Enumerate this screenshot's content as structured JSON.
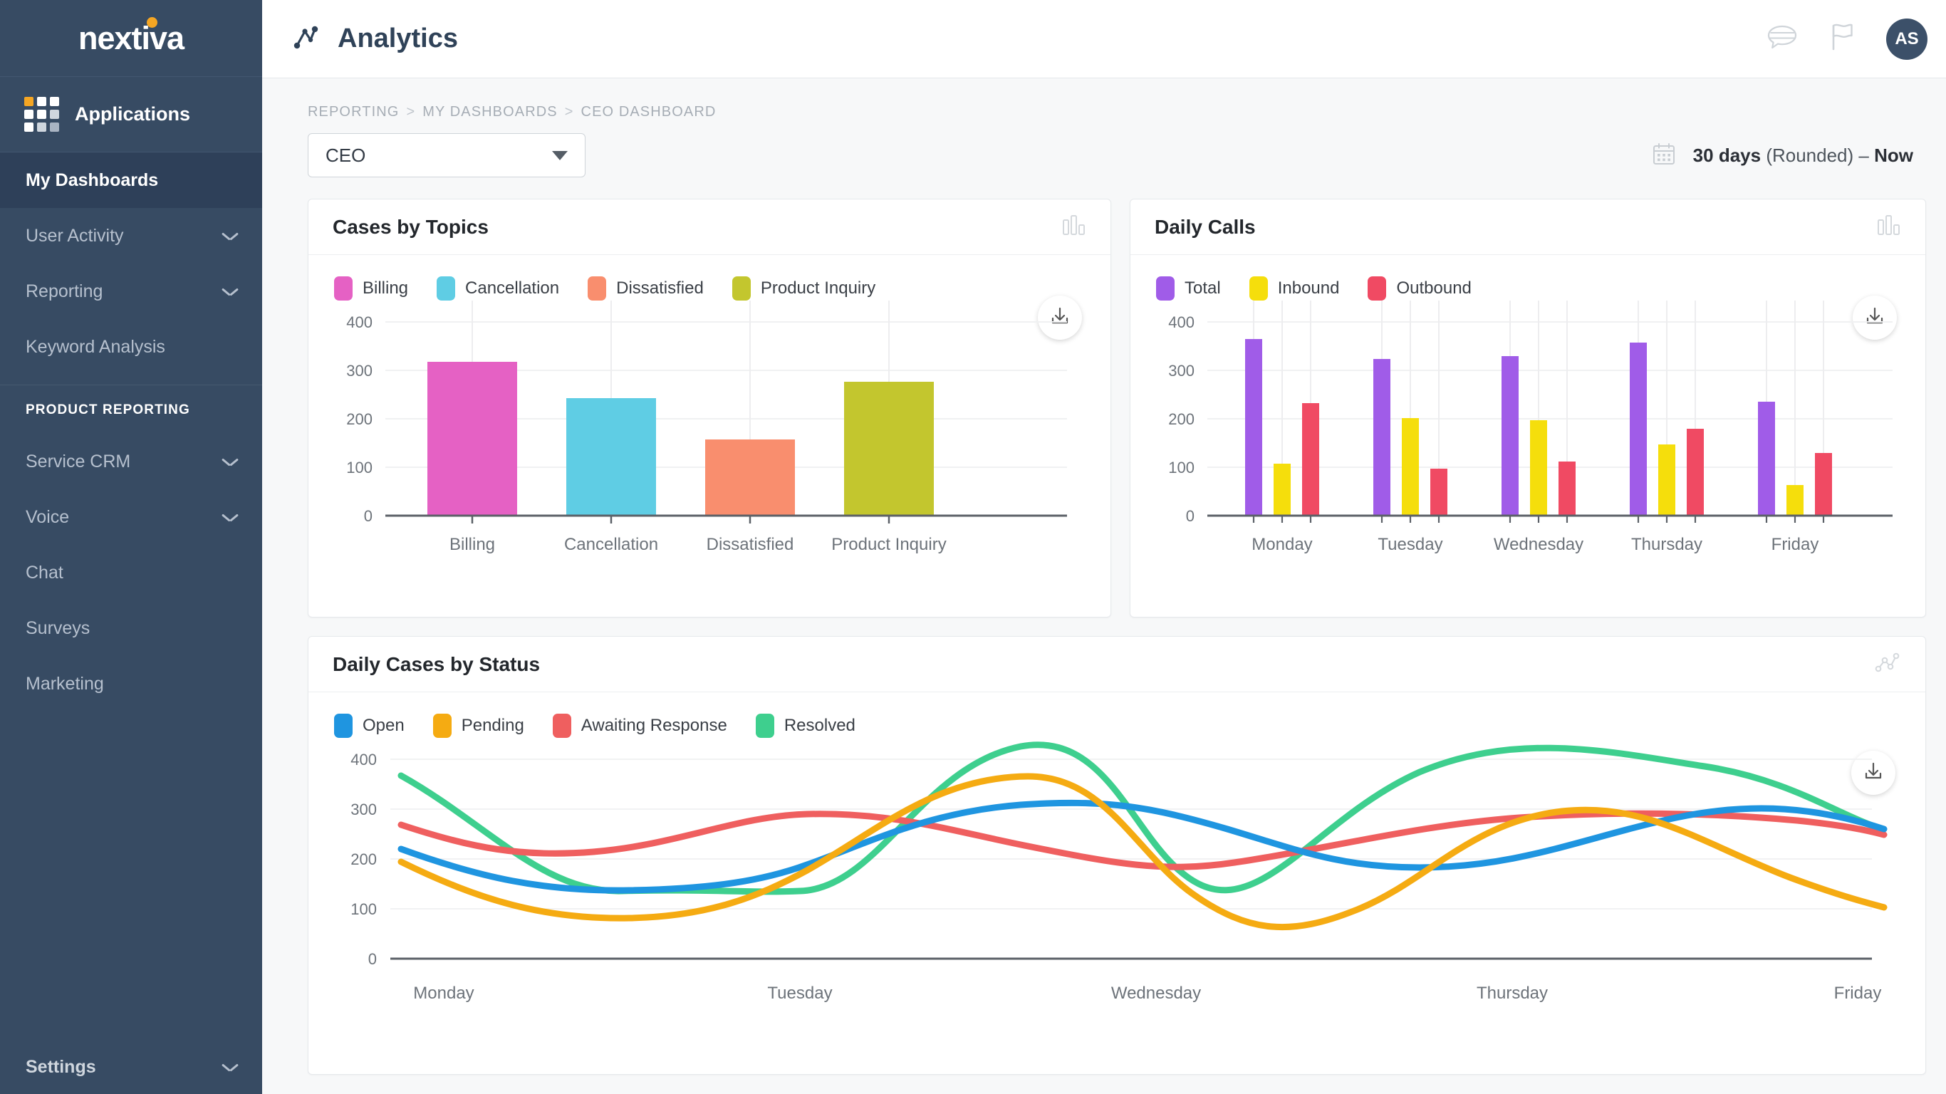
{
  "sidebar": {
    "logo": "nextiva",
    "applications_label": "Applications",
    "items": [
      {
        "label": "My Dashboards",
        "active": true,
        "chevron": false
      },
      {
        "label": "User Activity",
        "active": false,
        "chevron": true
      },
      {
        "label": "Reporting",
        "active": false,
        "chevron": true
      },
      {
        "label": "Keyword Analysis",
        "active": false,
        "chevron": false
      }
    ],
    "section_title": "PRODUCT REPORTING",
    "product_items": [
      {
        "label": "Service CRM",
        "chevron": true
      },
      {
        "label": "Voice",
        "chevron": true
      },
      {
        "label": "Chat",
        "chevron": false
      },
      {
        "label": "Surveys",
        "chevron": false
      },
      {
        "label": "Marketing",
        "chevron": false
      }
    ],
    "settings_label": "Settings"
  },
  "topbar": {
    "title": "Analytics",
    "avatar_initials": "AS"
  },
  "breadcrumb": {
    "items": [
      "REPORTING",
      "MY DASHBOARDS",
      "CEO DASHBOARD"
    ],
    "separator": ">"
  },
  "controls": {
    "dashboard_select_value": "CEO",
    "daterange_days": "30 days",
    "daterange_rounded": "(Rounded)",
    "daterange_dash": "–",
    "daterange_now": "Now"
  },
  "chart_data": [
    {
      "type": "bar",
      "title": "Cases by Topics",
      "categories": [
        "Billing",
        "Cancellation",
        "Dissatisfied",
        "Product Inquiry"
      ],
      "values": [
        318,
        243,
        158,
        277
      ],
      "colors": [
        "#e561c4",
        "#5fcde4",
        "#f98e6e",
        "#c3c62e"
      ],
      "legend": [
        "Billing",
        "Cancellation",
        "Dissatisfied",
        "Product Inquiry"
      ],
      "legend_position": "top-left",
      "yticks": [
        0,
        100,
        200,
        300,
        400
      ],
      "ylim": [
        0,
        440
      ],
      "xlabel": "",
      "ylabel": "",
      "grid": true,
      "header_icon": "bar-chart-icon",
      "download_label": "download-icon"
    },
    {
      "type": "bar",
      "title": "Daily Calls",
      "categories": [
        "Monday",
        "Tuesday",
        "Wednesday",
        "Thursday",
        "Friday"
      ],
      "series": [
        {
          "name": "Total",
          "color": "#a05ce8",
          "values": [
            365,
            323,
            330,
            358,
            236
          ]
        },
        {
          "name": "Inbound",
          "color": "#f5de0c",
          "values": [
            107,
            202,
            197,
            147,
            63
          ]
        },
        {
          "name": "Outbound",
          "color": "#f04a63",
          "values": [
            232,
            97,
            112,
            180,
            130
          ]
        }
      ],
      "legend": [
        "Total",
        "Inbound",
        "Outbound"
      ],
      "legend_position": "top-left",
      "yticks": [
        0,
        100,
        200,
        300,
        400
      ],
      "ylim": [
        0,
        440
      ],
      "xlabel": "",
      "ylabel": "",
      "grid": true,
      "header_icon": "bar-chart-icon",
      "download_label": "download-icon"
    },
    {
      "type": "line",
      "title": "Daily Cases by Status",
      "categories": [
        "Monday",
        "Tuesday",
        "Wednesday",
        "Thursday",
        "Friday"
      ],
      "series": [
        {
          "name": "Open",
          "color": "#1f95e0",
          "values": [
            222,
            140,
            312,
            188,
            300
          ]
        },
        {
          "name": "Pending",
          "color": "#f5ab12",
          "values": [
            196,
            92,
            365,
            62,
            310
          ]
        },
        {
          "name": "Awaiting Response",
          "color": "#ef5f5f",
          "values": [
            270,
            290,
            222,
            288,
            302
          ]
        },
        {
          "name": "Resolved",
          "color": "#3ecf8e",
          "values": [
            368,
            136,
            430,
            140,
            418
          ]
        }
      ],
      "legend": [
        "Open",
        "Pending",
        "Awaiting Response",
        "Resolved"
      ],
      "legend_position": "top-left",
      "yticks": [
        0,
        100,
        200,
        300,
        400
      ],
      "ylim": [
        0,
        460
      ],
      "xlabel": "",
      "ylabel": "",
      "grid": true,
      "header_icon": "line-chart-icon",
      "download_label": "download-icon"
    }
  ]
}
